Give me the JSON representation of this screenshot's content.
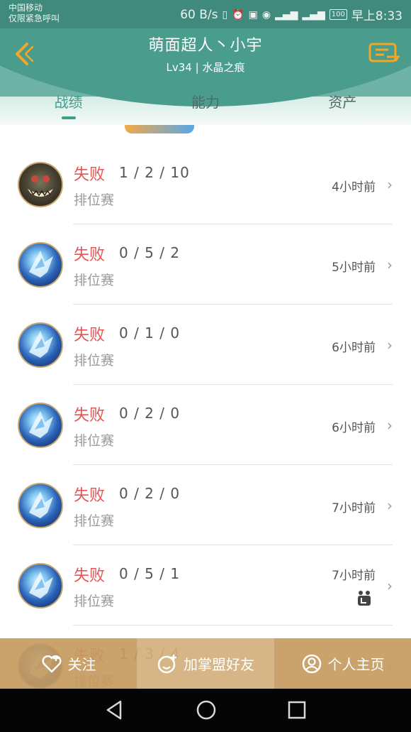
{
  "status_bar": {
    "carrier_line1": "中国移动",
    "carrier_line2": "仅限紧急呼叫",
    "speed": "60 B/s",
    "battery": "100",
    "time": "早上8:33"
  },
  "header": {
    "title": "萌面超人丶小宇",
    "subtitle": "Lv34 | 水晶之痕",
    "tabs": [
      {
        "label": "战绩",
        "active": true
      },
      {
        "label": "能力",
        "active": false
      },
      {
        "label": "资产",
        "active": false
      }
    ]
  },
  "matches": [
    {
      "result": "失败",
      "kda": "1 / 2 / 10",
      "mode": "排位赛",
      "time": "4小时前",
      "hero": "monster"
    },
    {
      "result": "失败",
      "kda": "0 / 5 / 2",
      "mode": "排位赛",
      "time": "5小时前",
      "hero": "dragon"
    },
    {
      "result": "失败",
      "kda": "0 / 1 / 0",
      "mode": "排位赛",
      "time": "6小时前",
      "hero": "dragon"
    },
    {
      "result": "失败",
      "kda": "0 / 2 / 0",
      "mode": "排位赛",
      "time": "6小时前",
      "hero": "dragon"
    },
    {
      "result": "失败",
      "kda": "0 / 2 / 0",
      "mode": "排位赛",
      "time": "7小时前",
      "hero": "dragon"
    },
    {
      "result": "失败",
      "kda": "0 / 5 / 1",
      "mode": "排位赛",
      "time": "7小时前",
      "hero": "dragon",
      "has_team_icon": true
    },
    {
      "result": "失败",
      "kda": "1 / 3 / 4",
      "mode": "排位赛",
      "time": "",
      "hero": "dragon"
    }
  ],
  "actions": {
    "follow": "关注",
    "add_friend": "加掌盟好友",
    "homepage": "个人主页"
  },
  "colors": {
    "header": "#4a9c8d",
    "accent": "#3f9d8a",
    "loss": "#e45656",
    "action_bar": "#c49a60",
    "back_icon": "#f5a623"
  }
}
